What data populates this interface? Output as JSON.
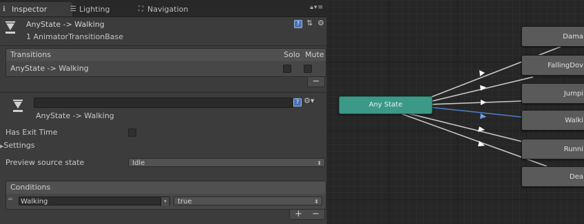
{
  "tabs": [
    {
      "label": "Inspector",
      "icon": "info-icon",
      "active": true
    },
    {
      "label": "Lighting",
      "icon": "lighting-icon",
      "active": false
    },
    {
      "label": "Navigation",
      "icon": "navigation-icon",
      "active": false
    }
  ],
  "header": {
    "title": "AnyState -> Walking",
    "subtitle": "1 AnimatorTransitionBase"
  },
  "transitions": {
    "title": "Transitions",
    "col_solo": "Solo",
    "col_mute": "Mute",
    "rows": [
      {
        "label": "AnyState -> Walking",
        "solo": false,
        "mute": false
      }
    ],
    "remove_label": "−"
  },
  "transition": {
    "name_value": "",
    "label": "AnyState -> Walking"
  },
  "properties": {
    "has_exit_time_label": "Has Exit Time",
    "has_exit_time": false,
    "settings_label": "Settings",
    "preview_label": "Preview source state",
    "preview_value": "Idle"
  },
  "conditions": {
    "title": "Conditions",
    "rows": [
      {
        "parameter": "Walking",
        "value": "true"
      }
    ],
    "add_label": "+",
    "remove_label": "−"
  },
  "graph": {
    "any_state": "Any State",
    "states": [
      "Dama",
      "FallingDov",
      "Jumpi",
      "Walki",
      "Runni",
      "Dea"
    ],
    "selected_transition": "Walki",
    "colors": {
      "any_state": "#3c9987",
      "state": "#5a5a5a",
      "selected_line": "#4a7bc0",
      "line": "#c8c8c8"
    }
  }
}
